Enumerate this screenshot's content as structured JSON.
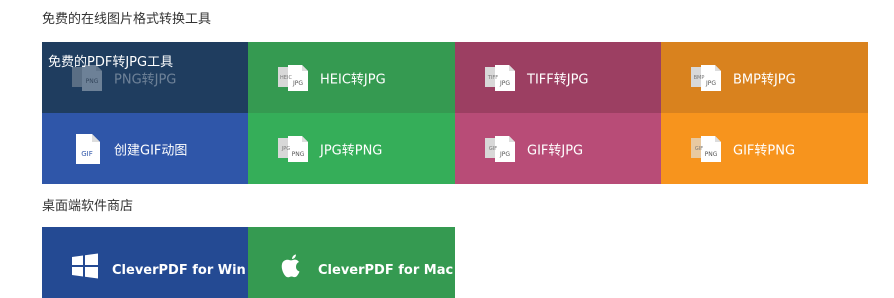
{
  "sections": {
    "converters_title": "免费的在线图片格式转换工具",
    "desktop_title": "桌面端软件商店"
  },
  "converter_tiles": [
    {
      "label": "PNG转JPG",
      "overlay": "免费的PDF转JPG工具",
      "color": "#1f3d5f",
      "icon": "png-file-icon",
      "badge": "PNG"
    },
    {
      "label": "HEIC转JPG",
      "color": "#359a51",
      "icon": "heic-file-icon",
      "badge": "HEIC"
    },
    {
      "label": "TIFF转JPG",
      "color": "#9c3f62",
      "icon": "tiff-file-icon",
      "badge": "TIFF"
    },
    {
      "label": "BMP转JPG",
      "color": "#d9821e",
      "icon": "bmp-file-icon",
      "badge": "BMP"
    },
    {
      "label": "创建GIF动图",
      "color": "#2f56a9",
      "icon": "gif-file-icon",
      "badge": "GIF"
    },
    {
      "label": "JPG转PNG",
      "color": "#35ae59",
      "icon": "jpg-file-icon",
      "badge": "JPG"
    },
    {
      "label": "GIF转JPG",
      "color": "#b84c77",
      "icon": "gif-file-icon",
      "badge": "GIF"
    },
    {
      "label": "GIF转PNG",
      "color": "#f7941d",
      "icon": "gif-file-icon",
      "badge": "GIF"
    }
  ],
  "desktop_tiles": [
    {
      "label": "CleverPDF for Win",
      "color": "#244a93",
      "icon": "windows-logo-icon"
    },
    {
      "label": "CleverPDF for Mac",
      "color": "#359a51",
      "icon": "apple-logo-icon"
    }
  ]
}
